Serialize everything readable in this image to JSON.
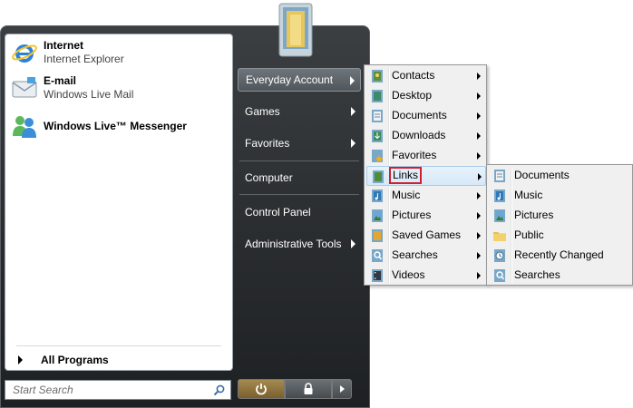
{
  "pinned": [
    {
      "title": "Internet",
      "subtitle": "Internet Explorer",
      "icon": "internet-explorer-icon"
    },
    {
      "title": "E-mail",
      "subtitle": "Windows Live Mail",
      "icon": "windows-live-mail-icon"
    },
    {
      "title": "Windows Live™ Messenger",
      "subtitle": "",
      "icon": "windows-live-messenger-icon"
    }
  ],
  "all_programs_label": "All Programs",
  "search": {
    "placeholder": "Start Search"
  },
  "right_pane": [
    {
      "label": "Everyday Account",
      "has_arrow": true,
      "active": true
    },
    {
      "label": "Games",
      "has_arrow": true
    },
    {
      "label": "Favorites",
      "has_arrow": true
    },
    {
      "label": "Computer",
      "has_arrow": false
    },
    {
      "label": "Control Panel",
      "has_arrow": false
    },
    {
      "label": "Administrative Tools",
      "has_arrow": true
    }
  ],
  "user_folder_menu": [
    {
      "label": "Contacts",
      "icon": "contacts-folder-icon"
    },
    {
      "label": "Desktop",
      "icon": "desktop-folder-icon"
    },
    {
      "label": "Documents",
      "icon": "documents-folder-icon"
    },
    {
      "label": "Downloads",
      "icon": "downloads-folder-icon"
    },
    {
      "label": "Favorites",
      "icon": "favorites-folder-icon"
    },
    {
      "label": "Links",
      "icon": "links-folder-icon",
      "highlighted": true
    },
    {
      "label": "Music",
      "icon": "music-folder-icon"
    },
    {
      "label": "Pictures",
      "icon": "pictures-folder-icon"
    },
    {
      "label": "Saved Games",
      "icon": "saved-games-folder-icon"
    },
    {
      "label": "Searches",
      "icon": "searches-folder-icon"
    },
    {
      "label": "Videos",
      "icon": "videos-folder-icon"
    }
  ],
  "links_menu": [
    {
      "label": "Documents",
      "icon": "documents-link-icon"
    },
    {
      "label": "Music",
      "icon": "music-link-icon"
    },
    {
      "label": "Pictures",
      "icon": "pictures-link-icon"
    },
    {
      "label": "Public",
      "icon": "public-folder-icon"
    },
    {
      "label": "Recently Changed",
      "icon": "recently-changed-icon"
    },
    {
      "label": "Searches",
      "icon": "searches-link-icon"
    }
  ],
  "colors": {
    "highlight_outline": "#d21f2c",
    "menu_hover": "#d6e8f8",
    "start_menu_bg": "#2a2d30"
  }
}
